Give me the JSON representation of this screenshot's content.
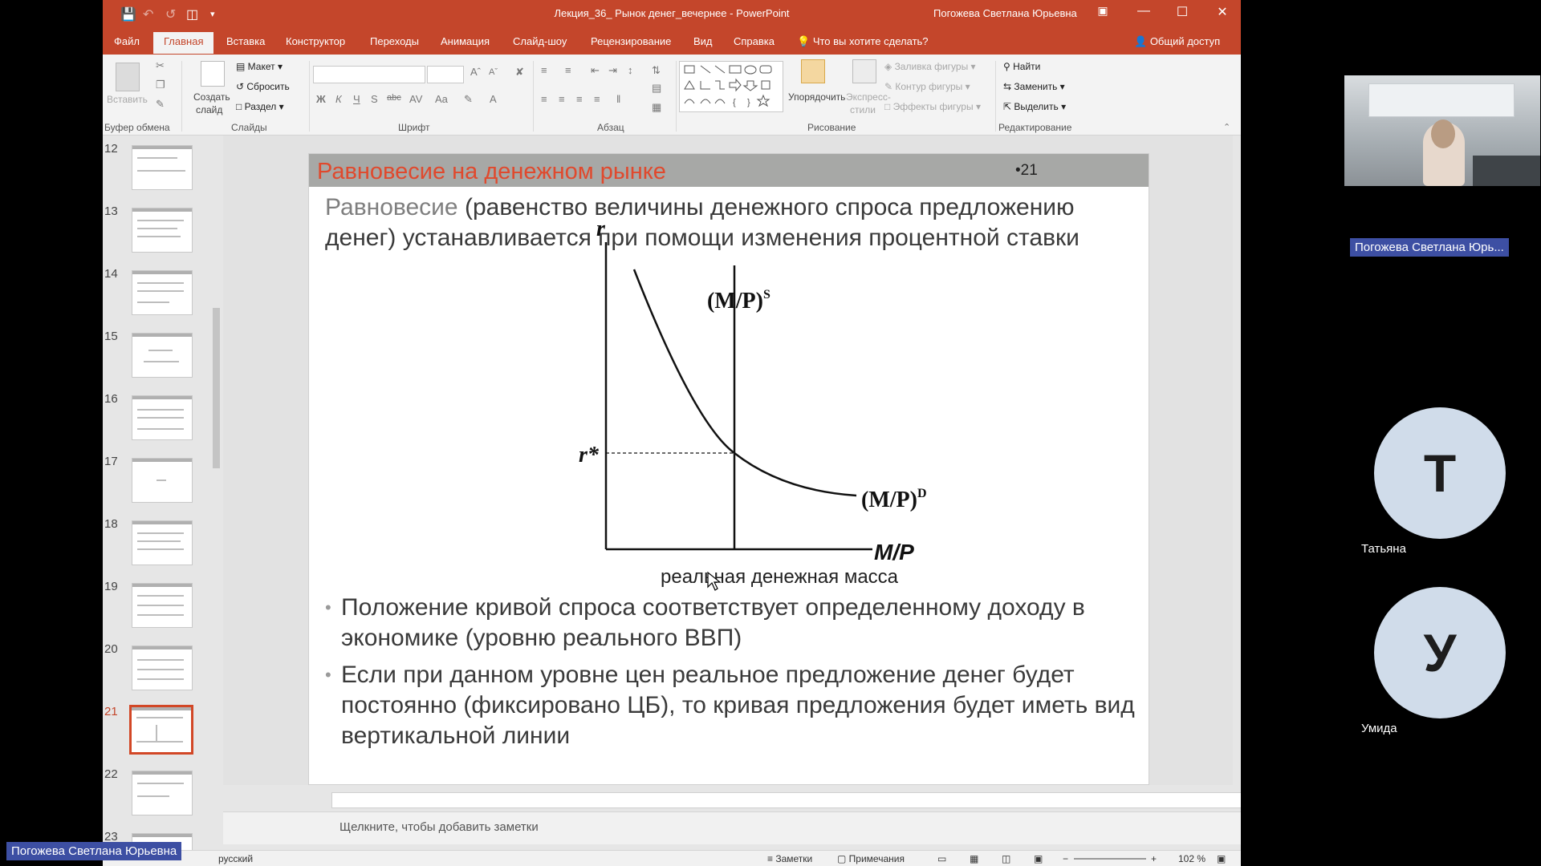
{
  "window": {
    "title": "Лекция_36_ Рынок денег_вечернее  -  PowerPoint",
    "user": "Погожева Светлана Юрьевна"
  },
  "tabs": [
    "Файл",
    "Главная",
    "Вставка",
    "Конструктор",
    "Переходы",
    "Анимация",
    "Слайд-шоу",
    "Рецензирование",
    "Вид",
    "Справка"
  ],
  "tell_me": "Что вы хотите сделать?",
  "share": "Общий доступ",
  "ribbon": {
    "paste": "Вставить",
    "new_slide": "Создать",
    "new_slide2": "слайд",
    "layout": "Макет",
    "reset": "Сбросить",
    "section": "Раздел",
    "arrange": "Упорядочить",
    "quick_styles": "Экспресс-",
    "quick_styles2": "стили",
    "shape_fill": "Заливка фигуры",
    "shape_outline": "Контур фигуры",
    "shape_effects": "Эффекты фигуры",
    "find": "Найти",
    "replace": "Заменить",
    "select": "Выделить",
    "groups": {
      "clipboard": "Буфер обмена",
      "slides": "Слайды",
      "font": "Шрифт",
      "paragraph": "Абзац",
      "drawing": "Рисование",
      "editing": "Редактирование"
    }
  },
  "thumbnails": [
    "12",
    "13",
    "14",
    "15",
    "16",
    "17",
    "18",
    "19",
    "20",
    "21",
    "22",
    "23"
  ],
  "current_slide": "21",
  "slide": {
    "title": "Равновесие на денежном рынке",
    "number": "•21",
    "intro_accent": "Равновесие",
    "intro_rest": " (равенство величины денежного спроса предложению денег) устанавливается при помощи изменения процентной ставки",
    "bullets": [
      "Положение кривой спроса соответствует определенному доходу в экономике (уровню реального ВВП)",
      "Если при данном уровне цен реальное предложение денег будет постоянно (фиксировано ЦБ), то кривая предложения будет иметь вид вертикальной линии"
    ],
    "x_caption": "реальная денежная масса"
  },
  "chart_data": {
    "type": "line",
    "y_axis_label": "r",
    "x_axis_label": "M/P",
    "equilibrium_label": "r*",
    "series": [
      {
        "name": "(M/P)S",
        "shape": "vertical line"
      },
      {
        "name": "(M/P)D",
        "shape": "downward-sloping curve"
      }
    ]
  },
  "notes_placeholder": "Щелкните, чтобы добавить заметки",
  "status": {
    "language": "русский",
    "notes": "Заметки",
    "comments": "Примечания",
    "zoom": "102 %"
  },
  "conference": {
    "presenter_tag": "Погожева Светлана Юрь...",
    "bottom_tag": "Погожева Светлана Юрьевна",
    "participants": [
      {
        "initial": "Т",
        "name": "Татьяна"
      },
      {
        "initial": "У",
        "name": "Умида"
      }
    ]
  },
  "colors": {
    "accent": "#c4462b",
    "title_red": "#e0492d",
    "avatar_bg": "#d0dcea",
    "name_tag": "#3d4fa3"
  }
}
